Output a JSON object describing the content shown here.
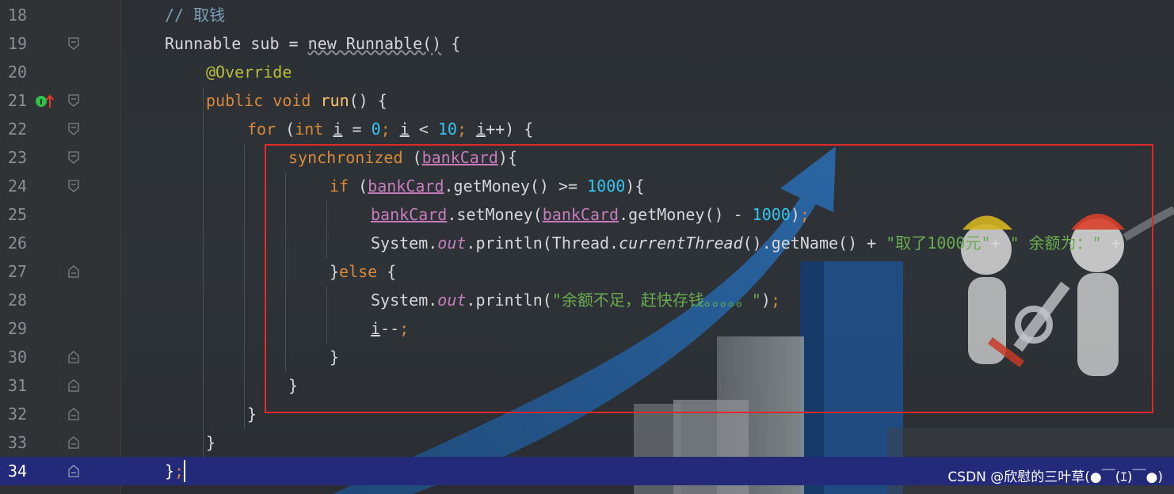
{
  "editor": {
    "lines": [
      {
        "n": "18"
      },
      {
        "n": "19"
      },
      {
        "n": "20"
      },
      {
        "n": "21"
      },
      {
        "n": "22"
      },
      {
        "n": "23"
      },
      {
        "n": "24"
      },
      {
        "n": "25"
      },
      {
        "n": "26"
      },
      {
        "n": "27"
      },
      {
        "n": "28"
      },
      {
        "n": "29"
      },
      {
        "n": "30"
      },
      {
        "n": "31"
      },
      {
        "n": "32"
      },
      {
        "n": "33"
      },
      {
        "n": "34"
      }
    ],
    "code": {
      "l18": "// 取钱",
      "l19_a": "Runnable sub = ",
      "l19_b": "new Runnable()",
      "l19_c": " {",
      "l20": "@Override",
      "l21_kw": "public void ",
      "l21_fn": "run",
      "l21_rest": "() {",
      "l22_kw": "for ",
      "l22_a": "(",
      "l22_int": "int ",
      "l22_i1": "i",
      "l22_b": " = ",
      "l22_n0": "0",
      "l22_s1": "; ",
      "l22_i2": "i",
      "l22_c": " < ",
      "l22_n10": "10",
      "l22_s2": "; ",
      "l22_i3": "i",
      "l22_d": "++) {",
      "l23_kw": "synchronized ",
      "l23_a": "(",
      "l23_f": "bankCard",
      "l23_b": "){",
      "l24_kw": "if ",
      "l24_a": "(",
      "l24_f": "bankCard",
      "l24_b": ".getMoney() >= ",
      "l24_n": "1000",
      "l24_c": "){",
      "l25_f1": "bankCard",
      "l25_a": ".setMoney(",
      "l25_f2": "bankCard",
      "l25_b": ".getMoney() - ",
      "l25_n": "1000",
      "l25_c": ")",
      "l25_semi": ";",
      "l26_a": "System.",
      "l26_out": "out",
      "l26_b": ".println(Thread.",
      "l26_ct": "currentThread",
      "l26_c": "().getName() + ",
      "l26_s1": "\"取了1000元\"",
      "l26_d": "+ ",
      "l26_s2": "\" 余额为：\" ",
      "l26_e": "+",
      "l27_a": "}",
      "l27_kw": "else",
      "l27_b": " {",
      "l28_a": "System.",
      "l28_out": "out",
      "l28_b": ".println(",
      "l28_s": "\"余额不足，赶快存钱。。。。。\"",
      "l28_c": ")",
      "l28_semi": ";",
      "l29_i": "i",
      "l29_a": "--",
      "l29_semi": ";",
      "l30": "}",
      "l31": "}",
      "l32": "}",
      "l33": "}",
      "l34_a": "}",
      "l34_semi": ";"
    },
    "marker_label": "I"
  },
  "watermark": "CSDN @欣慰的三叶草(●￣(ｴ)￣●)",
  "colors": {
    "keyword": "#d9893a",
    "comment": "#7a9fb8",
    "annotation": "#b9bd3a",
    "number": "#34c6f2",
    "string": "#6aab4f",
    "field": "#c77dbb",
    "current_line": "#232a7a",
    "highlight_box": "#e0292b"
  }
}
